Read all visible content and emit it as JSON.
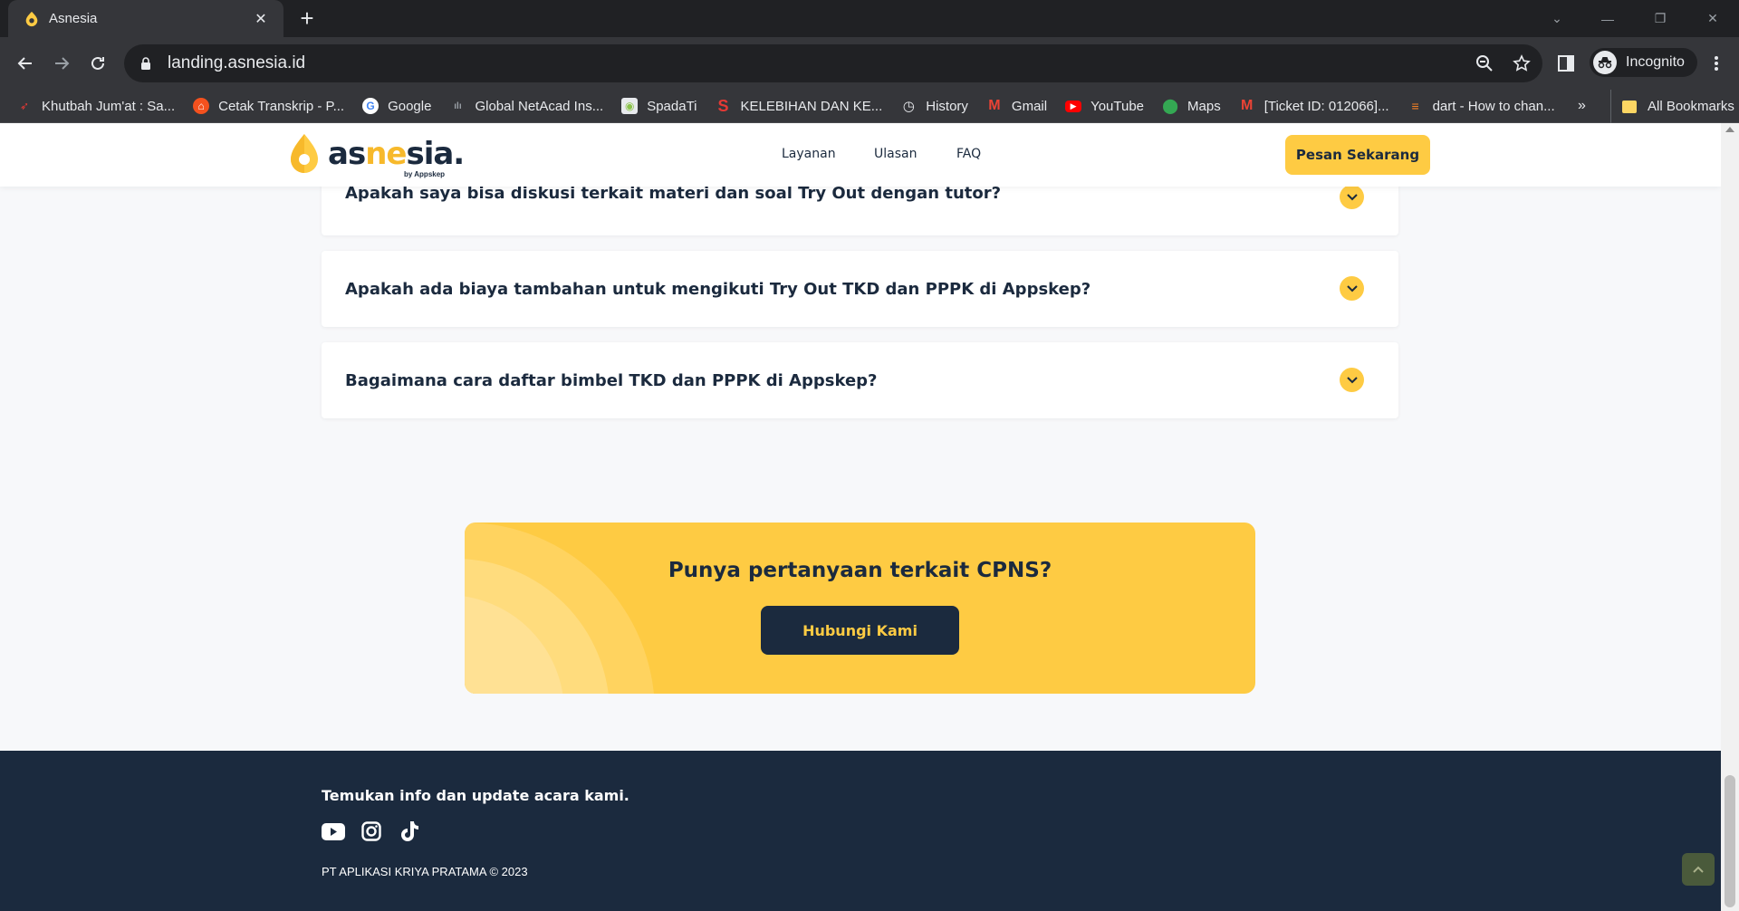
{
  "browser": {
    "tab_title": "Asnesia",
    "url": "landing.asnesia.id",
    "profile_label": "Incognito",
    "bookmarks": [
      {
        "label": "Khutbah Jum'at : Sa...",
        "icon": "red-bird-icon",
        "color": "#e53935"
      },
      {
        "label": "Cetak Transkrip - P...",
        "icon": "grad-cap-icon",
        "color": "#f4511e"
      },
      {
        "label": "Google",
        "icon": "google-icon",
        "color": "#ffffff"
      },
      {
        "label": "Global NetAcad Ins...",
        "icon": "cisco-icon",
        "color": "#9aa0a6"
      },
      {
        "label": "SpadaTi",
        "icon": "spada-icon",
        "color": "#8bc34a"
      },
      {
        "label": "KELEBIHAN DAN KE...",
        "icon": "s-icon",
        "color": "#e53935"
      },
      {
        "label": "History",
        "icon": "history-icon",
        "color": "#e8eaed"
      },
      {
        "label": "Gmail",
        "icon": "gmail-icon",
        "color": "#ea4335"
      },
      {
        "label": "YouTube",
        "icon": "youtube-icon",
        "color": "#ff0000"
      },
      {
        "label": "Maps",
        "icon": "maps-icon",
        "color": "#34a853"
      },
      {
        "label": "[Ticket ID: 012066]...",
        "icon": "gmail-icon",
        "color": "#ea4335"
      },
      {
        "label": "dart - How to chan...",
        "icon": "stackoverflow-icon",
        "color": "#f48024"
      }
    ],
    "all_bookmarks_label": "All Bookmarks",
    "more_bookmarks_label": "»"
  },
  "header": {
    "logo_text_a": "as",
    "logo_text_b": "ne",
    "logo_text_c": "sia.",
    "logo_sub": "by Appskep",
    "nav": [
      "Layanan",
      "Ulasan",
      "FAQ"
    ],
    "cta_label": "Pesan Sekarang"
  },
  "faq": [
    "Apakah saya bisa diskusi terkait materi dan soal Try Out dengan tutor?",
    "Apakah ada biaya tambahan untuk mengikuti Try Out TKD dan PPPK di Appskep?",
    "Bagaimana cara daftar bimbel TKD dan PPPK di Appskep?"
  ],
  "cta_banner": {
    "title": "Punya pertanyaan terkait CPNS?",
    "button_label": "Hubungi Kami"
  },
  "footer": {
    "tagline": "Temukan info dan update acara kami.",
    "socials": [
      "youtube-icon",
      "instagram-icon",
      "tiktok-icon"
    ],
    "copyright": "PT APLIKASI KRIYA PRATAMA © 2023"
  },
  "colors": {
    "brand_yellow": "#fecb43",
    "brand_navy": "#1b2a3e"
  }
}
